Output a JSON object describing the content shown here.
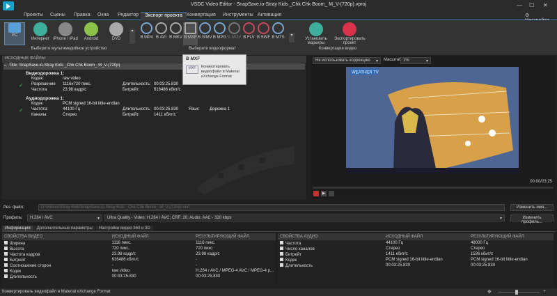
{
  "window": {
    "title": "VSDC Video Editor - SnapSave.io-Stray Kids _Chk Chk Boom_ M_V-(720p).vproj",
    "settings": "Настройки"
  },
  "menu": [
    "Проекты",
    "Сцены",
    "Правка",
    "Окна",
    "Редактор",
    "Экспорт проекта",
    "Конвертация",
    "Инструменты",
    "Активация"
  ],
  "ribbon": {
    "devices": [
      {
        "label": "PC",
        "icon": "monitor-icon",
        "color": "#5aa0d8"
      },
      {
        "label": "Интернет",
        "icon": "globe-icon",
        "color": "#3fae9c"
      },
      {
        "label": "iPhone / iPad",
        "icon": "apple-icon",
        "color": "#cccccc"
      },
      {
        "label": "Android",
        "icon": "android-icon",
        "color": "#8bc34a"
      },
      {
        "label": "DVD",
        "icon": "disc-icon",
        "color": "#aaaaaa"
      }
    ],
    "devices_group": "Выберите мультимедийное устройство",
    "formats": [
      "В MP4",
      "В AVI",
      "В MKV",
      "В MXF",
      "В WMV",
      "В MPG",
      "В MOV",
      "В FLV",
      "В SWF",
      "В MTS"
    ],
    "format_colors": [
      "#7aa6cf",
      "#aaaaaa",
      "#aaaaaa",
      "#aaaaaa",
      "#7aa6cf",
      "#7aa6cf",
      "#aaaaaa",
      "#c84a5a",
      "#c84a5a",
      "#7aa6cf"
    ],
    "formats_group": "Выберите видеоформат",
    "convert": [
      {
        "label": "Установить маркеры",
        "color": "#3fae9c"
      },
      {
        "label": "Экспортировать проект",
        "color": "#d8334a"
      }
    ],
    "convert_group": "Конвертация видео"
  },
  "tooltip": {
    "title": "В MXF",
    "text": "Конвертировать видеофайл в Material eXchange Format"
  },
  "source": {
    "header": "ИСХОДНЫЕ ФАЙЛЫ",
    "file_title": "Title: SnapSave.io-Stray Kids _Chk Chk Boom_ M_V-(720p)",
    "video_track": "Видеодорожка 1:",
    "video_rows": [
      [
        "Кодек:",
        "raw video",
        "",
        "",
        "",
        ""
      ],
      [
        "Разрешение",
        "1116x720 пикс.",
        "Длительность:",
        "00:03:25.830",
        "Аспект:",
        "-"
      ],
      [
        "Частота",
        "23.98 кадр/с",
        "Битрейт:",
        "616486 кбит/с",
        "",
        ""
      ]
    ],
    "audio_track": "Аудиодорожка 1:",
    "audio_rows": [
      [
        "Кодек",
        "PCM signed 16-bit little-endian",
        "",
        "",
        "",
        ""
      ],
      [
        "Частота:",
        "44100 Гц",
        "Длительность:",
        "00:03:25.830",
        "Язык:",
        "Дорожка 1"
      ],
      [
        "Каналы:",
        "Стерео",
        "Битрейт:",
        "1411 кбит/с",
        "",
        ""
      ]
    ]
  },
  "preview": {
    "correction": "Не использовать коррекцию",
    "zoom_label": "Масштаб:",
    "zoom": "1%",
    "time": "00:00/03:25",
    "weather": "WEATHER TV"
  },
  "output": {
    "file_label": "Рез. файл:",
    "file_path": "D:\\Videos\\Stray Kids\\SnapSave.io-Stray Kids _Chk Chk Boom_ M_V-(720p).mxf",
    "change_name": "Изменить имя...",
    "profile_label": "Профиль:",
    "codec": "H.264 / AVC",
    "profile": "Ultra Quality - Video: H.264 / AVC; CRF: 20; Audio: AAC - 320 kbps",
    "change_profile": "Изменить профиль..."
  },
  "tabs": [
    "Информация",
    "Дополнительные параметры",
    "Настройки видео 360 и 3D"
  ],
  "video_props": {
    "headers": [
      "СВОЙСТВА ВИДЕО",
      "ИСХОДНЫЙ ФАЙЛ",
      "РЕЗУЛЬТИРУЮЩИЙ ФАЙЛ"
    ],
    "rows": [
      [
        "Ширина",
        "1116 пикс.",
        "1116 пикс."
      ],
      [
        "Высота",
        "720 пикс.",
        "720 пикс."
      ],
      [
        "Частота кадров",
        "23.98 кадр/с",
        "23.98 кадр/с"
      ],
      [
        "Битрейт",
        "616486 кбит/с",
        "-"
      ],
      [
        "Соотношение сторон",
        "-",
        "-"
      ],
      [
        "Кодек",
        "raw video",
        "H.264 / AVC / MPEG-4 AVC / MPEG-4 p..."
      ],
      [
        "Длительность",
        "00:03:25.830",
        "00:03:25.830"
      ]
    ]
  },
  "audio_props": {
    "headers": [
      "СВОЙСТВА АУДИО",
      "ИСХОДНЫЙ ФАЙЛ",
      "РЕЗУЛЬТИРУЮЩИЙ ФАЙЛ"
    ],
    "rows": [
      [
        "Частота",
        "44100 Гц",
        "48000 Гц"
      ],
      [
        "Число каналов",
        "Стерео",
        "Стерео"
      ],
      [
        "Битрейт",
        "1411 кбит/с",
        "1536 кбит/с"
      ],
      [
        "Кодек",
        "PCM signed 16-bit little-endian",
        "PCM signed 16-bit little-endian"
      ],
      [
        "Длительность",
        "00:03:25.830",
        "00:03:25.830"
      ]
    ]
  },
  "status": {
    "text": "Конвертировать видеофайл в Material eXchange Format"
  }
}
